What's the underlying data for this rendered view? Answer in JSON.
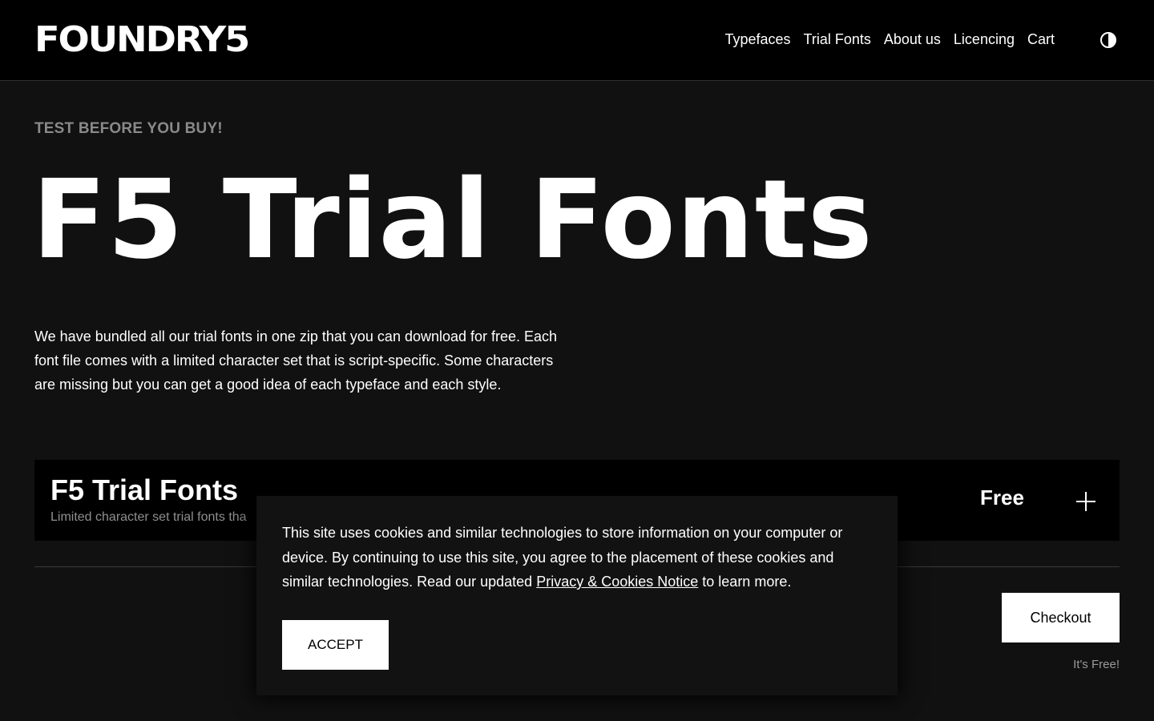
{
  "header": {
    "logo": "FOUNDRY5",
    "nav": [
      {
        "label": "Typefaces"
      },
      {
        "label": "Trial Fonts"
      },
      {
        "label": "About us"
      },
      {
        "label": "Licencing"
      },
      {
        "label": "Cart"
      }
    ],
    "theme_toggle_icon": "contrast-icon"
  },
  "hero": {
    "eyebrow": "TEST BEFORE YOU BUY!",
    "title": "F5 Trial Fonts",
    "intro": "We have bundled all our trial fonts in one zip that you can download for free. Each font file comes with a limited character set that is script-specific. Some characters are missing but you can get a good idea of each typeface and each style."
  },
  "product": {
    "name": "F5 Trial Fonts",
    "description": "Limited character set trial fonts tha",
    "price": "Free",
    "add_icon": "plus-icon"
  },
  "cart": {
    "checkout_label": "Checkout",
    "note": "It's Free!"
  },
  "cookie_banner": {
    "text_before": "This site uses cookies and similar technologies to store information on your computer or device. By continuing to use this site, you agree to the placement of these cookies and similar technologies. Read our updated ",
    "link_text": "Privacy & Cookies Notice",
    "text_after": " to learn more.",
    "accept_label": "ACCEPT"
  },
  "colors": {
    "background": "#111111",
    "header_bg": "#000000",
    "text": "#ffffff",
    "muted": "#8a8a8a",
    "button_bg": "#ffffff",
    "button_text": "#000000"
  }
}
